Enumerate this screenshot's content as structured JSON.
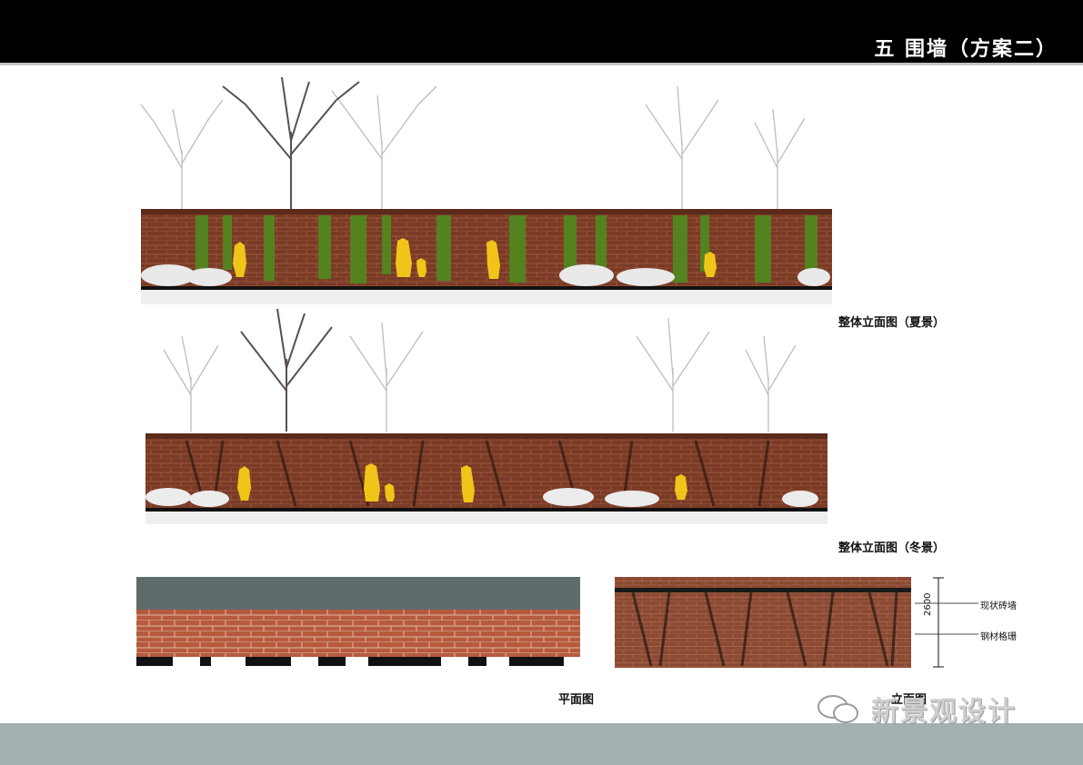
{
  "header": {
    "title": "五 围墙（方案二）"
  },
  "captions": {
    "summary": "整体立面图（夏景）",
    "winter": "整体立面图（冬景）",
    "plan": "平面图",
    "elevation": "立面图"
  },
  "annotations": {
    "brick_wall": "现状砖墙",
    "steel_grille": "钢材格珊",
    "height": "2600"
  },
  "watermark": {
    "text": "新景观设计",
    "icon": "wechat-icon"
  },
  "colors": {
    "brick": "#7a3b26",
    "vine": "#4f8a1e",
    "figure": "#f0c419",
    "header": "#000000",
    "footer": "#a4b0b0"
  }
}
